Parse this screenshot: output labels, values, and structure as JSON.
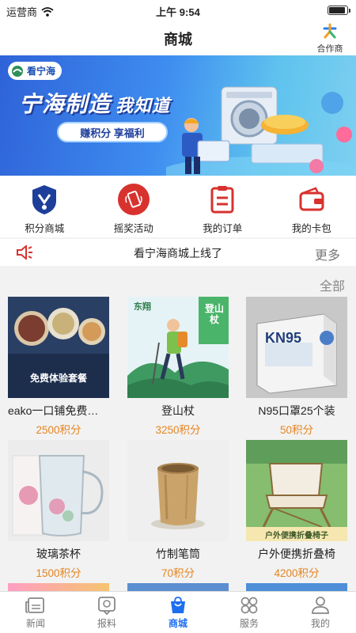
{
  "status_bar": {
    "carrier": "运营商",
    "time": "上午 9:54",
    "battery_level": 0.92
  },
  "nav": {
    "title": "商城",
    "partner_label": "合作商"
  },
  "banner": {
    "logo_text": "看宁海",
    "title": "宁海制造",
    "title_sub": "我知道",
    "pill": "赚积分 享福利"
  },
  "quick_entries": [
    {
      "label": "积分商城",
      "icon": "badge-icon",
      "color": "#1d3f9a"
    },
    {
      "label": "摇奖活动",
      "icon": "shake-icon",
      "color": "#d8322e"
    },
    {
      "label": "我的订单",
      "icon": "order-icon",
      "color": "#d8322e"
    },
    {
      "label": "我的卡包",
      "icon": "wallet-icon",
      "color": "#d8322e"
    }
  ],
  "notice": {
    "text": "看宁海商城上线了",
    "more": "更多"
  },
  "section": {
    "all_label": "全部"
  },
  "products": [
    {
      "name": "eako一口铺免费体验套餐",
      "points": "2500积分",
      "img_text": "免费体验套餐"
    },
    {
      "name": "登山杖",
      "points": "3250积分",
      "img_text": "登山杖",
      "img_brand": "东翔"
    },
    {
      "name": "N95口罩25个装",
      "points": "50积分",
      "img_text": "KN95"
    },
    {
      "name": "玻璃茶杯",
      "points": "1500积分"
    },
    {
      "name": "竹制笔筒",
      "points": "70积分"
    },
    {
      "name": "户外便携折叠椅",
      "points": "4200积分",
      "img_text": "户外便携折叠椅子"
    }
  ],
  "tabs": [
    {
      "label": "新闻",
      "icon": "news-icon",
      "active": false
    },
    {
      "label": "报料",
      "icon": "report-icon",
      "active": false
    },
    {
      "label": "商城",
      "icon": "shop-bag-icon",
      "active": true
    },
    {
      "label": "服务",
      "icon": "service-icon",
      "active": false
    },
    {
      "label": "我的",
      "icon": "profile-icon",
      "active": false
    }
  ],
  "colors": {
    "accent": "#1e6ff0",
    "points": "#e6841e",
    "red": "#d8322e"
  }
}
